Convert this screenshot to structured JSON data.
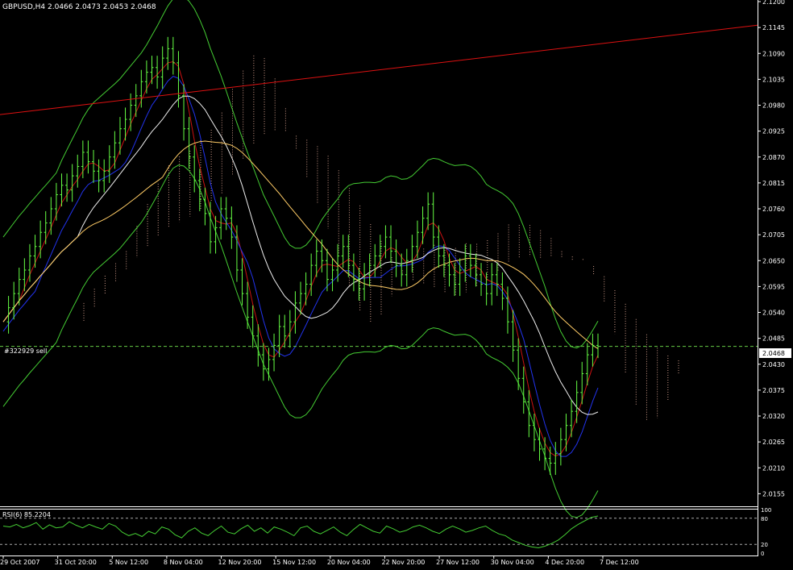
{
  "chart_data": {
    "type": "candlestick",
    "header": "GBPUSD,H4  2.0466 2.0473 2.0453 2.0468",
    "price_axis": {
      "ylim": [
        2.013,
        2.12
      ],
      "ticks": [
        "2.1200",
        "2.1145",
        "2.1090",
        "2.1035",
        "2.0980",
        "2.0925",
        "2.0870",
        "2.0815",
        "2.0760",
        "2.0705",
        "2.0650",
        "2.0595",
        "2.0540",
        "2.0485",
        "2.0430",
        "2.0375",
        "2.0320",
        "2.0265",
        "2.0210",
        "2.0155"
      ]
    },
    "current_price": "2.0468",
    "order_label": "#322929 sell",
    "time_axis": [
      "29 Oct 2007",
      "31 Oct 20:00",
      "5 Nov 12:00",
      "8 Nov 04:00",
      "12 Nov 20:00",
      "15 Nov 12:00",
      "20 Nov 04:00",
      "22 Nov 20:00",
      "27 Nov 12:00",
      "30 Nov 04:00",
      "4 Dec 20:00",
      "7 Dec 12:00"
    ],
    "close_series": [
      2.052,
      2.055,
      2.058,
      2.061,
      2.063,
      2.066,
      2.068,
      2.071,
      2.073,
      2.076,
      2.079,
      2.081,
      2.08,
      2.083,
      2.085,
      2.088,
      2.086,
      2.084,
      2.082,
      2.084,
      2.087,
      2.09,
      2.093,
      2.095,
      2.098,
      2.1,
      2.103,
      2.105,
      2.106,
      2.104,
      2.108,
      2.11,
      2.107,
      2.1,
      2.093,
      2.087,
      2.082,
      2.078,
      2.075,
      2.069,
      2.072,
      2.076,
      2.074,
      2.07,
      2.063,
      2.058,
      2.053,
      2.049,
      2.045,
      2.042,
      2.044,
      2.047,
      2.051,
      2.049,
      2.052,
      2.056,
      2.058,
      2.06,
      2.064,
      2.067,
      2.065,
      2.061,
      2.063,
      2.066,
      2.068,
      2.064,
      2.061,
      2.059,
      2.062,
      2.064,
      2.066,
      2.068,
      2.07,
      2.067,
      2.064,
      2.062,
      2.065,
      2.068,
      2.071,
      2.074,
      2.077,
      2.07,
      2.066,
      2.064,
      2.062,
      2.06,
      2.063,
      2.066,
      2.064,
      2.062,
      2.06,
      2.058,
      2.062,
      2.06,
      2.057,
      2.052,
      2.046,
      2.04,
      2.035,
      2.03,
      2.027,
      2.025,
      2.023,
      2.022,
      2.024,
      2.027,
      2.03,
      2.033,
      2.037,
      2.041,
      2.045,
      2.047,
      2.0468
    ],
    "resistance_line": {
      "start": 2.096,
      "end": 2.115
    },
    "indicator": {
      "label": "RSI(6) 85.2204",
      "ticks": [
        "100",
        "80",
        "20",
        "0"
      ],
      "levels": [
        80,
        20
      ],
      "ylim": [
        0,
        100
      ],
      "values": [
        62,
        60,
        66,
        58,
        63,
        70,
        55,
        65,
        58,
        60,
        72,
        64,
        58,
        66,
        60,
        55,
        68,
        62,
        48,
        40,
        45,
        38,
        50,
        44,
        60,
        55,
        42,
        35,
        50,
        58,
        46,
        40,
        52,
        62,
        48,
        44,
        56,
        64,
        50,
        58,
        46,
        60,
        55,
        48,
        40,
        58,
        62,
        50,
        44,
        52,
        60,
        48,
        40,
        54,
        66,
        58,
        50,
        46,
        62,
        56,
        48,
        52,
        60,
        64,
        58,
        50,
        45,
        55,
        62,
        56,
        48,
        52,
        58,
        62,
        52,
        44,
        40,
        30,
        24,
        18,
        14,
        12,
        16,
        22,
        30,
        42,
        56,
        66,
        74,
        82,
        85.2204
      ]
    },
    "colors": {
      "background": "#000000",
      "candles": "#66ff44",
      "bands": "#44cc33",
      "resistance": "#dd1111",
      "tenkan": "#cc1111",
      "kijun": "#2233ee",
      "ma_white": "#eeeeee",
      "ma_orange": "#ffcc66",
      "cloud": "#cc9988",
      "axis": "#ffffff",
      "price_tag_bg": "#ffffff"
    }
  }
}
